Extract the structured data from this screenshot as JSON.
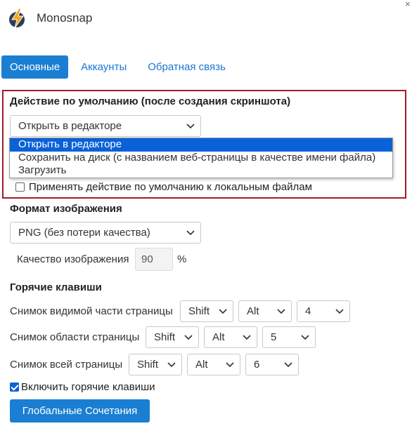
{
  "window": {
    "app_title": "Monosnap",
    "close_glyph": "×"
  },
  "tabs": [
    {
      "label": "Основные",
      "active": true
    },
    {
      "label": "Аккаунты",
      "active": false
    },
    {
      "label": "Обратная связь",
      "active": false
    }
  ],
  "default_action": {
    "title": "Действие по умолчанию (после создания скриншота)",
    "selected": "Открыть в редакторе",
    "options": [
      "Открыть в редакторе",
      "Сохранить на диск (с названием веб-страницы в качестве имени файла)",
      "Загрузить"
    ],
    "apply_local_label": "Применять действие по умолчанию к локальным файлам",
    "apply_local_checked": false
  },
  "image_format": {
    "title": "Формат изображения",
    "selected": "PNG (без потери качества)",
    "quality_label": "Качество изображения",
    "quality_value": "90",
    "quality_unit": "%"
  },
  "hotkeys": {
    "title": "Горячие клавиши",
    "rows": [
      {
        "label": "Снимок видимой части страницы",
        "mod1": "Shift",
        "mod2": "Alt",
        "key": "4"
      },
      {
        "label": "Снимок области страницы",
        "mod1": "Shift",
        "mod2": "Alt",
        "key": "5"
      },
      {
        "label": "Снимок всей страницы",
        "mod1": "Shift",
        "mod2": "Alt",
        "key": "6"
      }
    ],
    "enable_label": "Включить горячие клавиши",
    "enable_checked": true,
    "global_button": "Глобальные Сочетания"
  },
  "colors": {
    "accent": "#1a7fd2",
    "highlight_box": "#a01c2a",
    "selected_option": "#0a61d8"
  },
  "icons": {
    "logo": "monosnap-lightning-logo",
    "chevron": "chevron-down-icon",
    "close": "close-icon"
  }
}
